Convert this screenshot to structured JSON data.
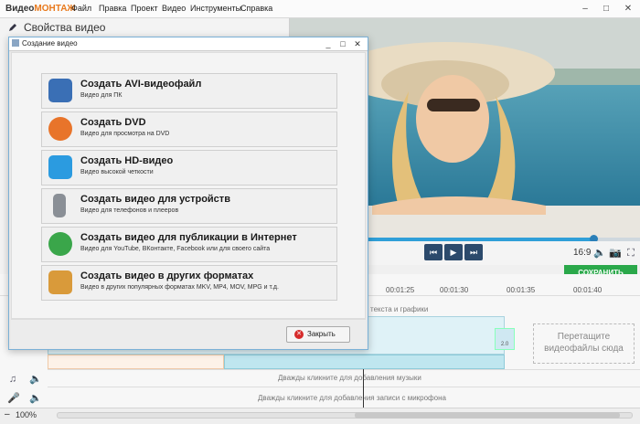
{
  "app": {
    "logo_prefix": "Видео",
    "logo_brand": "МОНТАЖ",
    "menu": [
      "Файл",
      "Правка",
      "Проект",
      "Видео",
      "Инструменты",
      "Справка"
    ],
    "window_controls": [
      "–",
      "□",
      "✕"
    ]
  },
  "left_panel": {
    "title": "Свойства видео"
  },
  "player": {
    "aspect_ratio": "16:9",
    "progress": 0.87,
    "save_button": "СОХРАНИТЬ ВИДЕО",
    "buttons": [
      "⏮",
      "▶",
      "⏭"
    ]
  },
  "timeline": {
    "ticks": [
      "00:01:25",
      "00:01:30",
      "00:01:35",
      "00:01:40"
    ],
    "text_track_hint": "текста и графики",
    "drop_zone": "Перетащите видеофайлы сюда",
    "thumb_label": "2.0",
    "music_hint": "Дважды кликните для добавления музыки",
    "mic_hint": "Дважды кликните для добавления записи с микрофона",
    "zoom": "100%",
    "zoom_minus": "–"
  },
  "dialog": {
    "title": "Создание видео",
    "controls": [
      "_",
      "□",
      "✕"
    ],
    "options": [
      {
        "title": "Создать AVI-видеофайл",
        "subtitle": "Видео для ПК",
        "icon": "avi-file-icon",
        "color": "#3a6fb5"
      },
      {
        "title": "Создать DVD",
        "subtitle": "Видео для просмотра на DVD",
        "icon": "dvd-disc-icon",
        "color": "#e8742a"
      },
      {
        "title": "Создать HD-видео",
        "subtitle": "Видео высокой четкости",
        "icon": "hd-monitor-icon",
        "color": "#2b9be0"
      },
      {
        "title": "Создать видео для устройств",
        "subtitle": "Видео для телефонов и плееров",
        "icon": "phone-device-icon",
        "color": "#8a8f96"
      },
      {
        "title": "Создать видео для публикации в Интернет",
        "subtitle": "Видео для YouTube, ВКонтакте, Facebook или для своего сайта",
        "icon": "globe-internet-icon",
        "color": "#3aa64a"
      },
      {
        "title": "Создать видео в других форматах",
        "subtitle": "Видео в других популярных форматах MKV, MP4, MOV, MPG и т.д.",
        "icon": "film-reel-icon",
        "color": "#d99a3a"
      }
    ],
    "close_button": "Закрыть"
  }
}
